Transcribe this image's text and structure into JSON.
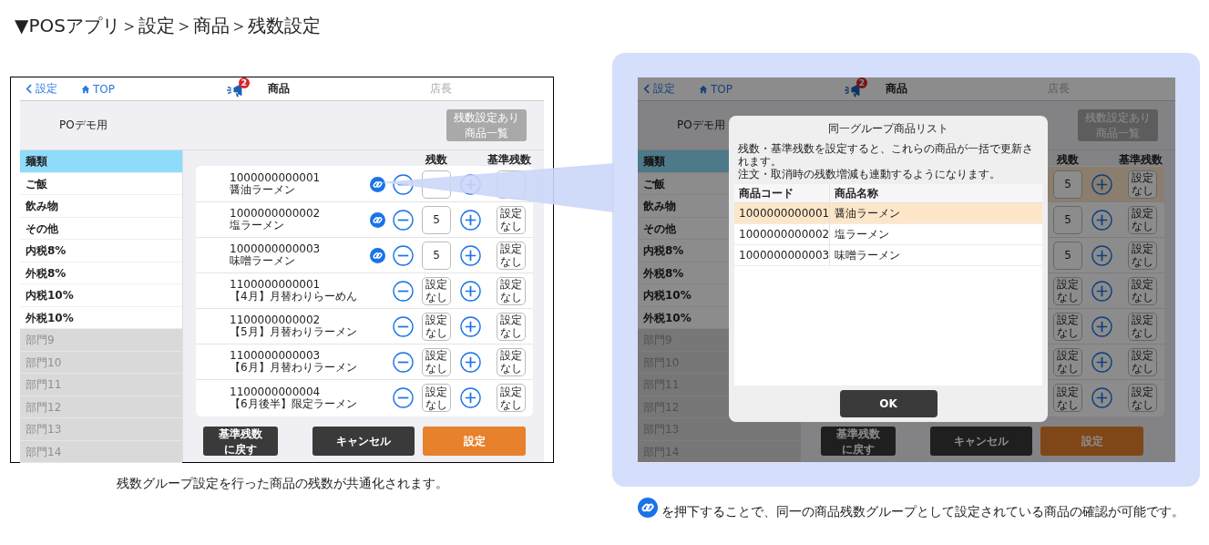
{
  "page_title": "▼POSアプリ＞設定＞商品＞残数設定",
  "screens": [
    {
      "header": {
        "back": "設定",
        "home": "TOP",
        "badge": "2",
        "title": "商品",
        "user": "店長"
      },
      "shop": "POデモ用",
      "list_button": [
        "残数設定あり",
        "商品一覧"
      ],
      "sidebar": [
        {
          "label": "麺類",
          "selected": true,
          "disabled": false
        },
        {
          "label": "ご飯",
          "selected": false,
          "disabled": false
        },
        {
          "label": "飲み物",
          "selected": false,
          "disabled": false
        },
        {
          "label": "その他",
          "selected": false,
          "disabled": false
        },
        {
          "label": "内税8%",
          "selected": false,
          "disabled": false
        },
        {
          "label": "外税8%",
          "selected": false,
          "disabled": false
        },
        {
          "label": "内税10%",
          "selected": false,
          "disabled": false
        },
        {
          "label": "外税10%",
          "selected": false,
          "disabled": false
        },
        {
          "label": "部門9",
          "selected": false,
          "disabled": true
        },
        {
          "label": "部門10",
          "selected": false,
          "disabled": true
        },
        {
          "label": "部門11",
          "selected": false,
          "disabled": true
        },
        {
          "label": "部門12",
          "selected": false,
          "disabled": true
        },
        {
          "label": "部門13",
          "selected": false,
          "disabled": true
        },
        {
          "label": "部門14",
          "selected": false,
          "disabled": true
        }
      ],
      "columns": [
        "残数",
        "基準残数"
      ],
      "rows": [
        {
          "code": "1000000000001",
          "name": "醤油ラーメン",
          "linked": true,
          "selected": false
        },
        {
          "code": "1000000000002",
          "name": "塩ラーメン",
          "linked": true,
          "stock": "5",
          "base": "設定なし",
          "selected": false
        },
        {
          "code": "1000000000003",
          "name": "味噌ラーメン",
          "linked": true,
          "stock": "5",
          "base": "設定なし",
          "selected": false
        },
        {
          "code": "1100000000001",
          "name": "【4月】月替わりらーめん",
          "linked": false,
          "stock": "設定なし",
          "base": "設定なし",
          "selected": false
        },
        {
          "code": "1100000000002",
          "name": "【5月】月替わりラーメン",
          "linked": false,
          "stock": "設定なし",
          "base": "設定なし",
          "selected": false
        },
        {
          "code": "1100000000003",
          "name": "【6月】月替わりラーメン",
          "linked": false,
          "stock": "設定なし",
          "base": "設定なし",
          "selected": false
        },
        {
          "code": "1100000000004",
          "name": "【6月後半】限定ラーメン",
          "linked": false,
          "stock": "設定なし",
          "base": "設定なし",
          "selected": false
        }
      ],
      "buttons": [
        "基準残数に戻す",
        "キャンセル",
        "設定"
      ],
      "dimmed": false,
      "caption": "残数グループ設定を行った商品の残数が共通化されます。"
    },
    {
      "header": {
        "back": "設定",
        "home": "TOP",
        "badge": "2",
        "title": "商品",
        "user": "店長"
      },
      "shop": "POデモ用",
      "list_button": [
        "残数設定あり",
        "商品一覧"
      ],
      "sidebar": [
        {
          "label": "麺類",
          "selected": true,
          "disabled": false
        },
        {
          "label": "ご飯",
          "selected": false,
          "disabled": false
        },
        {
          "label": "飲み物",
          "selected": false,
          "disabled": false
        },
        {
          "label": "その他",
          "selected": false,
          "disabled": false
        },
        {
          "label": "内税8%",
          "selected": false,
          "disabled": false
        },
        {
          "label": "外税8%",
          "selected": false,
          "disabled": false
        },
        {
          "label": "内税10%",
          "selected": false,
          "disabled": false
        },
        {
          "label": "外税10%",
          "selected": false,
          "disabled": false
        },
        {
          "label": "部門9",
          "selected": false,
          "disabled": true
        },
        {
          "label": "部門10",
          "selected": false,
          "disabled": true
        },
        {
          "label": "部門11",
          "selected": false,
          "disabled": true
        },
        {
          "label": "部門12",
          "selected": false,
          "disabled": true
        },
        {
          "label": "部門13",
          "selected": false,
          "disabled": true
        },
        {
          "label": "部門14",
          "selected": false,
          "disabled": true
        }
      ],
      "columns": [
        "残数",
        "基準残数"
      ],
      "rows": [
        {
          "stock": "5",
          "base": "設定なし",
          "selected": true
        },
        {
          "stock": "5",
          "base": "設定なし",
          "selected": false
        },
        {
          "stock": "5",
          "base": "設定なし",
          "selected": false
        },
        {
          "stock": "設定なし",
          "base": "設定なし",
          "selected": false
        },
        {
          "stock": "設定なし",
          "base": "設定なし",
          "selected": false
        },
        {
          "stock": "設定なし",
          "base": "設定なし",
          "selected": false
        },
        {
          "stock": "設定なし",
          "base": "設定なし",
          "selected": false
        }
      ],
      "buttons": [
        "基準残数に戻す",
        "キャンセル",
        "設定"
      ],
      "dimmed": true,
      "dialog": {
        "title": "同一グループ商品リスト",
        "message": [
          "残数・基準残数を設定すると、これらの商品が一括で更新されます。",
          "注文・取消時の残数増減も連動するようになります。"
        ],
        "columns": [
          "商品コード",
          "商品名称"
        ],
        "rows": [
          {
            "code": "1000000000001",
            "name": "醤油ラーメン",
            "selected": true
          },
          {
            "code": "1000000000002",
            "name": "塩ラーメン",
            "selected": false
          },
          {
            "code": "1000000000003",
            "name": "味噌ラーメン",
            "selected": false
          }
        ],
        "ok": "OK"
      },
      "caption": "を押下することで、同一の商品残数グループとして設定されている商品の確認が可能です。"
    }
  ]
}
